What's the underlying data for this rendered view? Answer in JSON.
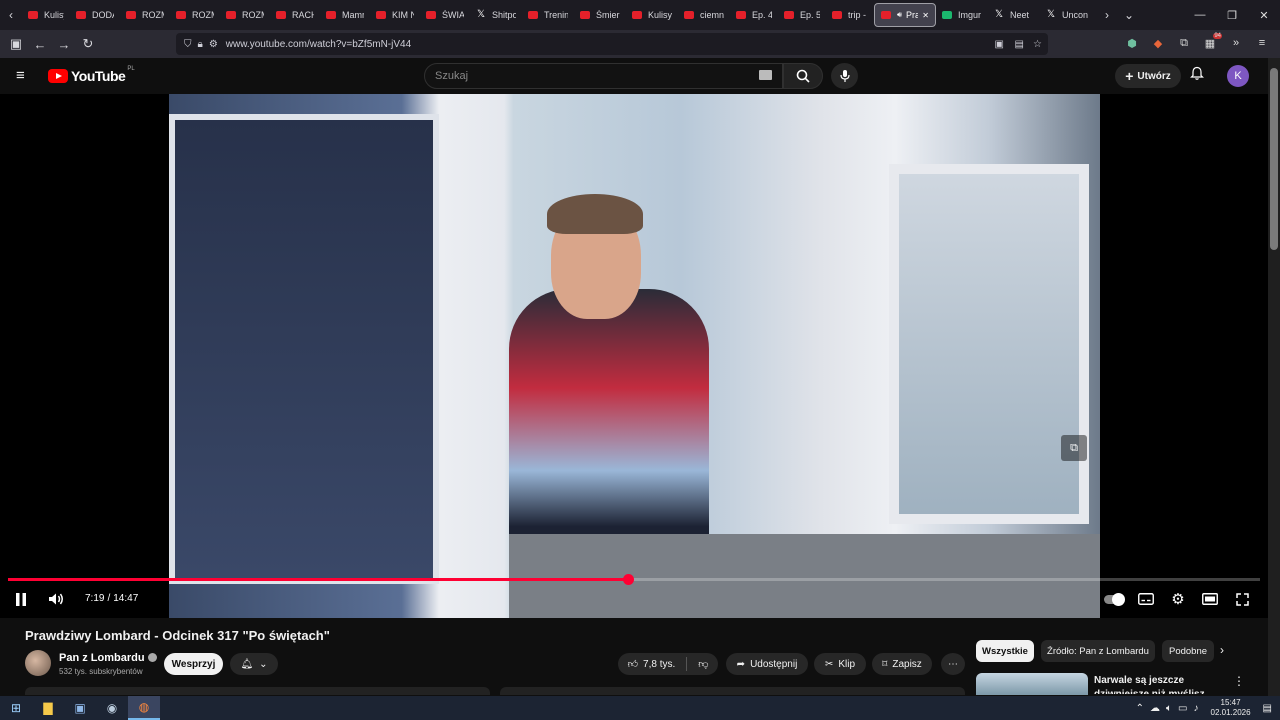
{
  "browser": {
    "tabs": [
      {
        "label": "Kulisy",
        "icon": "youtube-icon"
      },
      {
        "label": "DODA",
        "icon": "youtube-icon"
      },
      {
        "label": "ROZM",
        "icon": "youtube-icon"
      },
      {
        "label": "ROZM",
        "icon": "youtube-icon"
      },
      {
        "label": "ROZM",
        "icon": "youtube-icon"
      },
      {
        "label": "RACH",
        "icon": "youtube-icon"
      },
      {
        "label": "Mamr",
        "icon": "youtube-icon"
      },
      {
        "label": "KIM N",
        "icon": "youtube-icon"
      },
      {
        "label": "ŚWIAT",
        "icon": "youtube-icon"
      },
      {
        "label": "Shitpo",
        "icon": "x-icon"
      },
      {
        "label": "Trenin",
        "icon": "youtube-icon"
      },
      {
        "label": "Śmier",
        "icon": "youtube-icon"
      },
      {
        "label": "Kulisy",
        "icon": "youtube-icon"
      },
      {
        "label": "ciemn",
        "icon": "youtube-icon"
      },
      {
        "label": "Ep. 4",
        "icon": "youtube-icon"
      },
      {
        "label": "Ep. 5",
        "icon": "youtube-icon"
      },
      {
        "label": "trip -",
        "icon": "youtube-icon"
      },
      {
        "label": "Pra",
        "icon": "youtube-icon",
        "active": true
      },
      {
        "label": "Imgur",
        "icon": "imgur-icon"
      },
      {
        "label": "Neet",
        "icon": "x-icon"
      },
      {
        "label": "Uncon",
        "icon": "x-icon"
      }
    ],
    "url": "www.youtube.com/watch?v=bZf5mN-jV44",
    "ext_badge": "94"
  },
  "youtube": {
    "logo_text": "YouTube",
    "logo_region": "PL",
    "search_placeholder": "Szukaj",
    "create_label": "Utwórz",
    "avatar_letter": "K"
  },
  "player": {
    "current_time": "7:19",
    "duration": "14:47",
    "progress_fraction": 0.495
  },
  "video": {
    "title": "Prawdziwy Lombard - Odcinek 317 \"Po świętach\"",
    "channel": "Pan z Lombardu",
    "subscribers": "532 tys. subskrybentów",
    "support_label": "Wesprzyj",
    "likes": "7,8 tys.",
    "share_label": "Udostępnij",
    "clip_label": "Klip",
    "save_label": "Zapisz"
  },
  "sidebar": {
    "chips": [
      "Wszystkie",
      "Źródło: Pan z Lombardu",
      "Podobne"
    ],
    "rec_title": "Narwale są jeszcze dziwniejsze niż myślisz"
  },
  "taskbar": {
    "time": "15:47",
    "date": "02.01.2026"
  }
}
